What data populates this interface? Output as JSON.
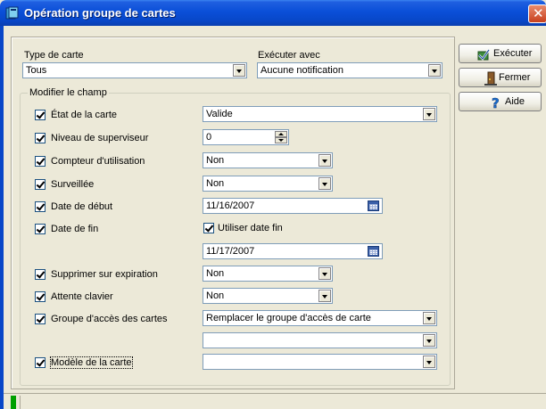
{
  "window": {
    "title": "Opération groupe de cartes",
    "close_glyph": "✕",
    "icon": "cards-app-icon"
  },
  "header": {
    "card_type_label": "Type de carte",
    "card_type_value": "Tous",
    "execute_with_label": "Exécuter avec",
    "execute_with_value": "Aucune notification"
  },
  "modify_group": {
    "legend": "Modifier le champ",
    "fields": {
      "card_state": {
        "label": "État de la carte",
        "checked": true,
        "value": "Valide"
      },
      "supervisor_level": {
        "label": "Niveau de superviseur",
        "checked": true,
        "value": "0"
      },
      "usage_counter": {
        "label": "Compteur d'utilisation",
        "checked": true,
        "value": "Non"
      },
      "monitored": {
        "label": "Surveillée",
        "checked": true,
        "value": "Non"
      },
      "start_date": {
        "label": "Date de début",
        "checked": true,
        "value": "11/16/2007"
      },
      "end_date": {
        "label": "Date de fin",
        "checked": true,
        "use_end_date_label": "Utiliser date fin",
        "use_end_date_checked": true,
        "value": "11/17/2007"
      },
      "delete_on_expiry": {
        "label": "Supprimer sur expiration",
        "checked": true,
        "value": "Non"
      },
      "keypad_wait": {
        "label": "Attente clavier",
        "checked": true,
        "value": "Non"
      },
      "access_group": {
        "label": "Groupe d'accès des cartes",
        "checked": true,
        "value": "Remplacer le groupe d'accès de carte",
        "second_value": ""
      },
      "card_template": {
        "label": "Modèle de la carte",
        "checked": true,
        "value": ""
      }
    }
  },
  "buttons": {
    "execute": "Exécuter",
    "close": "Fermer",
    "help": "Aide"
  },
  "colors": {
    "titlebar": "#0a4fd8",
    "window_bg": "#ece9d8",
    "status_green": "#00a000"
  }
}
